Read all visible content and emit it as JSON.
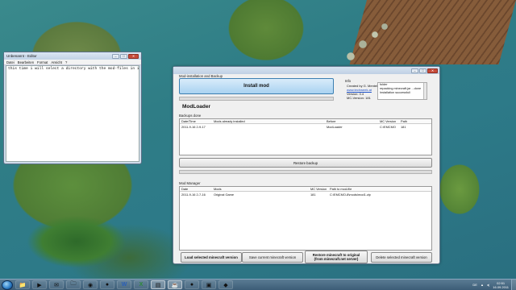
{
  "notepad": {
    "title": "Unbenannt - Editor",
    "menu": [
      "Datei",
      "Bearbeiten",
      "Format",
      "Ansicht",
      "?"
    ],
    "content": "this time i will select a directory with the mod-files in it:"
  },
  "modwin": {
    "install_group_label": "Mod-installation and Backup",
    "install_button": "Install mod",
    "info": {
      "label": "Info",
      "created_by": "Created by G. Mentek",
      "website": "www.techweek.at",
      "version": "Version: 0.4",
      "mc_version": "MC-Version: 181",
      "log": [
        "folder",
        "repacking minecraft.jar ...done",
        "Installation successfull"
      ]
    },
    "heading": "ModLoader",
    "backup_label": "Backups done",
    "backup_table": {
      "columns": [
        "Date/Time",
        "Mods already installed",
        "Before",
        "MC Version",
        "Path"
      ],
      "rows": [
        [
          "2011-9-16 2-9-17",
          "",
          "ModLoader",
          "C:\\EMCMO",
          "181"
        ]
      ]
    },
    "restore_button": "Restore backup",
    "manager_label": "Mod Manager",
    "mod_table": {
      "columns": [
        "Date",
        "Mods",
        "MC Version",
        "Path to mod-file"
      ],
      "rows": [
        [
          "2011-9-16 2-7-16",
          "Original Game",
          "181",
          "C:\\EMCMO-8\\mods\\mod1.zip"
        ]
      ]
    },
    "buttons": {
      "load": "Load selected minecraft version",
      "save": "Save current minecraft version",
      "restore_line1": "Restore minecraft to original",
      "restore_line2": "(from minecraft.net server)",
      "delete": "Delete selected minecraft version"
    }
  },
  "taskbar": {
    "tray_lang": "DE",
    "time": "02:51",
    "date": "16.09.2011"
  }
}
